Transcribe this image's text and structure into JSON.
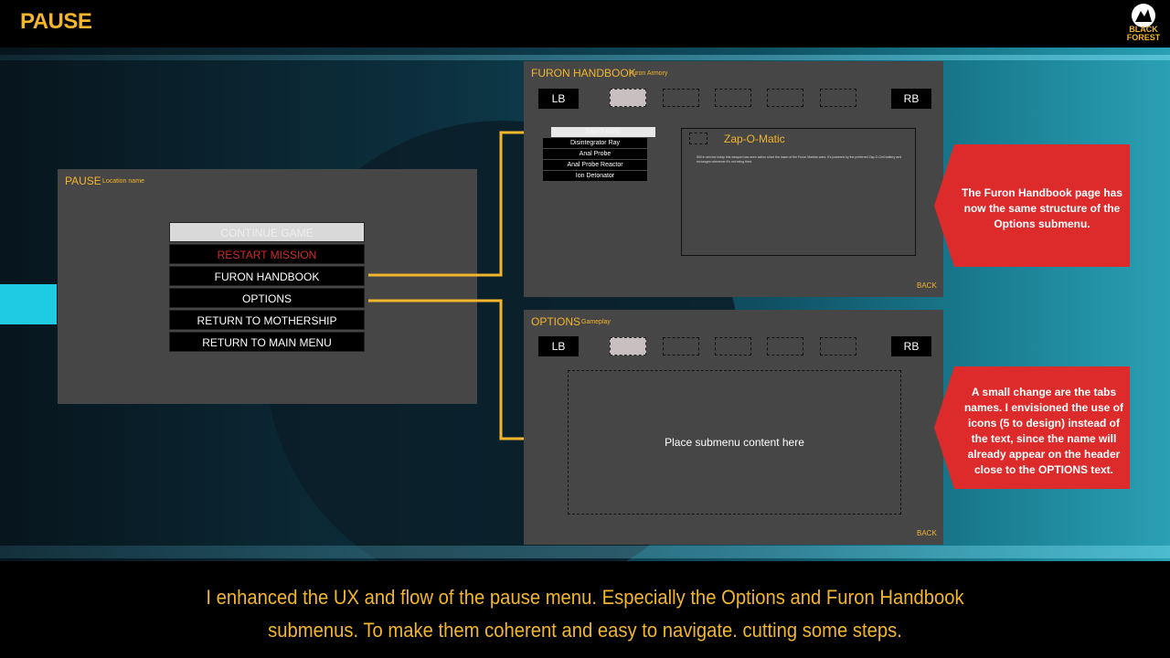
{
  "header": {
    "title": "PAUSE",
    "logo_text_1": "BLACK",
    "logo_text_2": "FOREST"
  },
  "pause_panel": {
    "title": "PAUSE",
    "subtitle": "Location name",
    "buttons": [
      {
        "label": "CONTINUE GAME"
      },
      {
        "label": "RESTART MISSION"
      },
      {
        "label": "FURON HANDBOOK"
      },
      {
        "label": "OPTIONS"
      },
      {
        "label": "RETURN TO MOTHERSHIP"
      },
      {
        "label": "RETURN TO MAIN MENU"
      }
    ]
  },
  "handbook_panel": {
    "title": "FURON HANDBOOK",
    "subtitle": "Furon Armory",
    "lb": "LB",
    "rb": "RB",
    "items": [
      {
        "label": "Zap-O-Matic"
      },
      {
        "label": "Disintegrator Ray"
      },
      {
        "label": "Anal Probe"
      },
      {
        "label": "Anal Probe Reactor"
      },
      {
        "label": "Ion Detonator"
      }
    ],
    "detail_name": "Zap-O-Matic",
    "detail_desc": "Still in service today this weapon has seen action since the dawn of the Furon Martian wars. It's powered by the preferred Zap-O-Cell battery and recharges whenever it's not being fired.",
    "back": "BACK"
  },
  "options_panel": {
    "title": "OPTIONS",
    "subtitle": "Gameplay",
    "lb": "LB",
    "rb": "RB",
    "content_placeholder": "Place submenu content here",
    "back": "BACK"
  },
  "callouts": {
    "top": "The Furon Handbook page has now the same structure of the Options submenu.",
    "bottom": "A small change are the tabs names. I envisioned the use of icons (5 to design) instead of the text, since the name will already appear on the header close to the OPTIONS text."
  },
  "caption": "I enhanced the UX and flow of the pause menu. Especially the Options and Furon Handbook submenus. To make them coherent and easy to navigate. cutting some steps.",
  "colors": {
    "accent": "#f2b52e",
    "panel": "#464646",
    "callout": "#dd2b2b",
    "highlight": "#1ecbe0"
  }
}
